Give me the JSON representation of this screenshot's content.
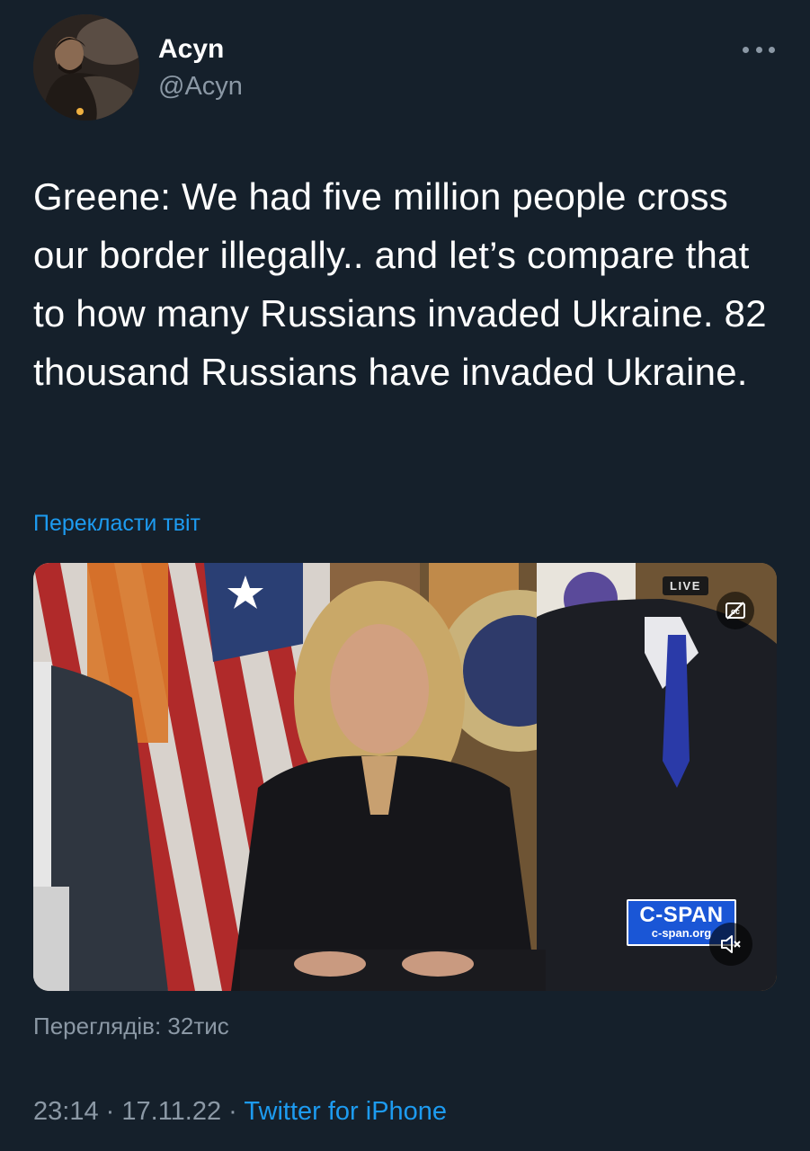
{
  "author": {
    "display_name": "Acyn",
    "handle": "@Acyn"
  },
  "tweet": {
    "text": "Greene: We had five million people cross our border illegally.. and let’s compare that to how many Russians invaded Ukraine. 82 thousand Russians have invaded Ukraine.",
    "translate_label": "Перекласти твіт"
  },
  "media": {
    "live_label": "LIVE",
    "network_logo": "C-SPAN",
    "network_url": "c-span.org",
    "icons": [
      "closed-captions-icon",
      "mute-icon"
    ]
  },
  "stats": {
    "views": "Переглядів: 32тис"
  },
  "meta": {
    "time": "23:14",
    "separator": "·",
    "date": "17.11.22",
    "source": "Twitter for iPhone"
  },
  "colors": {
    "background": "#15202b",
    "text_primary": "#ffffff",
    "text_secondary": "#8b98a5",
    "link": "#1d9bf0"
  }
}
